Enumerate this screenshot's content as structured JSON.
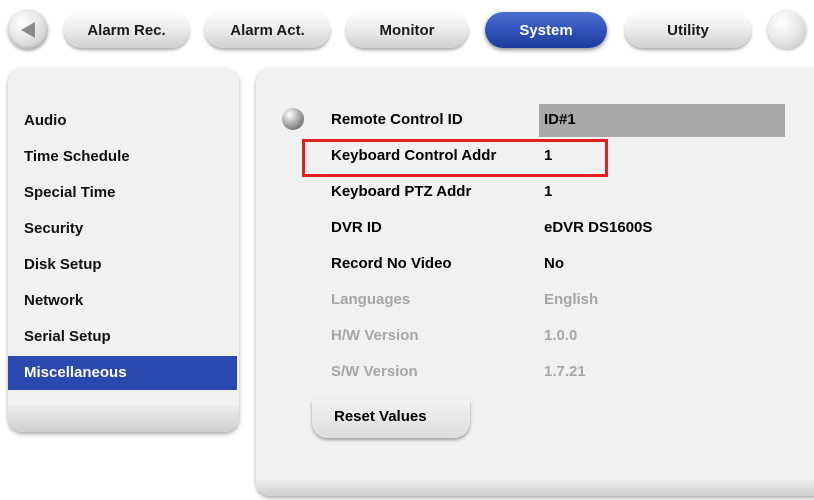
{
  "nav": {
    "back_icon": "left-arrow-icon",
    "tabs": [
      {
        "label": "Alarm Rec.",
        "active": false
      },
      {
        "label": "Alarm Act.",
        "active": false
      },
      {
        "label": "Monitor",
        "active": false
      },
      {
        "label": "System",
        "active": true
      },
      {
        "label": "Utility",
        "active": false
      }
    ]
  },
  "sidebar": {
    "items": [
      {
        "label": "Audio",
        "active": false
      },
      {
        "label": "Time Schedule",
        "active": false
      },
      {
        "label": "Special Time",
        "active": false
      },
      {
        "label": "Security",
        "active": false
      },
      {
        "label": "Disk Setup",
        "active": false
      },
      {
        "label": "Network",
        "active": false
      },
      {
        "label": "Serial Setup",
        "active": false
      },
      {
        "label": "Miscellaneous",
        "active": true
      }
    ]
  },
  "settings": {
    "rows": [
      {
        "label": "Remote Control ID",
        "value": "ID#1",
        "enabled": true,
        "selected": true
      },
      {
        "label": "Keyboard Control Addr",
        "value": "1",
        "enabled": true,
        "highlighted": true
      },
      {
        "label": "Keyboard PTZ Addr",
        "value": "1",
        "enabled": true
      },
      {
        "label": "DVR ID",
        "value": "eDVR DS1600S",
        "enabled": true
      },
      {
        "label": "Record No Video",
        "value": "No",
        "enabled": true
      },
      {
        "label": "Languages",
        "value": "English",
        "enabled": false
      },
      {
        "label": "H/W Version",
        "value": "1.0.0",
        "enabled": false
      },
      {
        "label": "S/W Version",
        "value": "1.7.21",
        "enabled": false
      }
    ],
    "reset_label": "Reset Values"
  },
  "colors": {
    "accent": "#2b48b0",
    "highlight": "#e02020",
    "selected_value_bg": "#a9a9a9",
    "disabled_text": "#a6a6a6"
  }
}
